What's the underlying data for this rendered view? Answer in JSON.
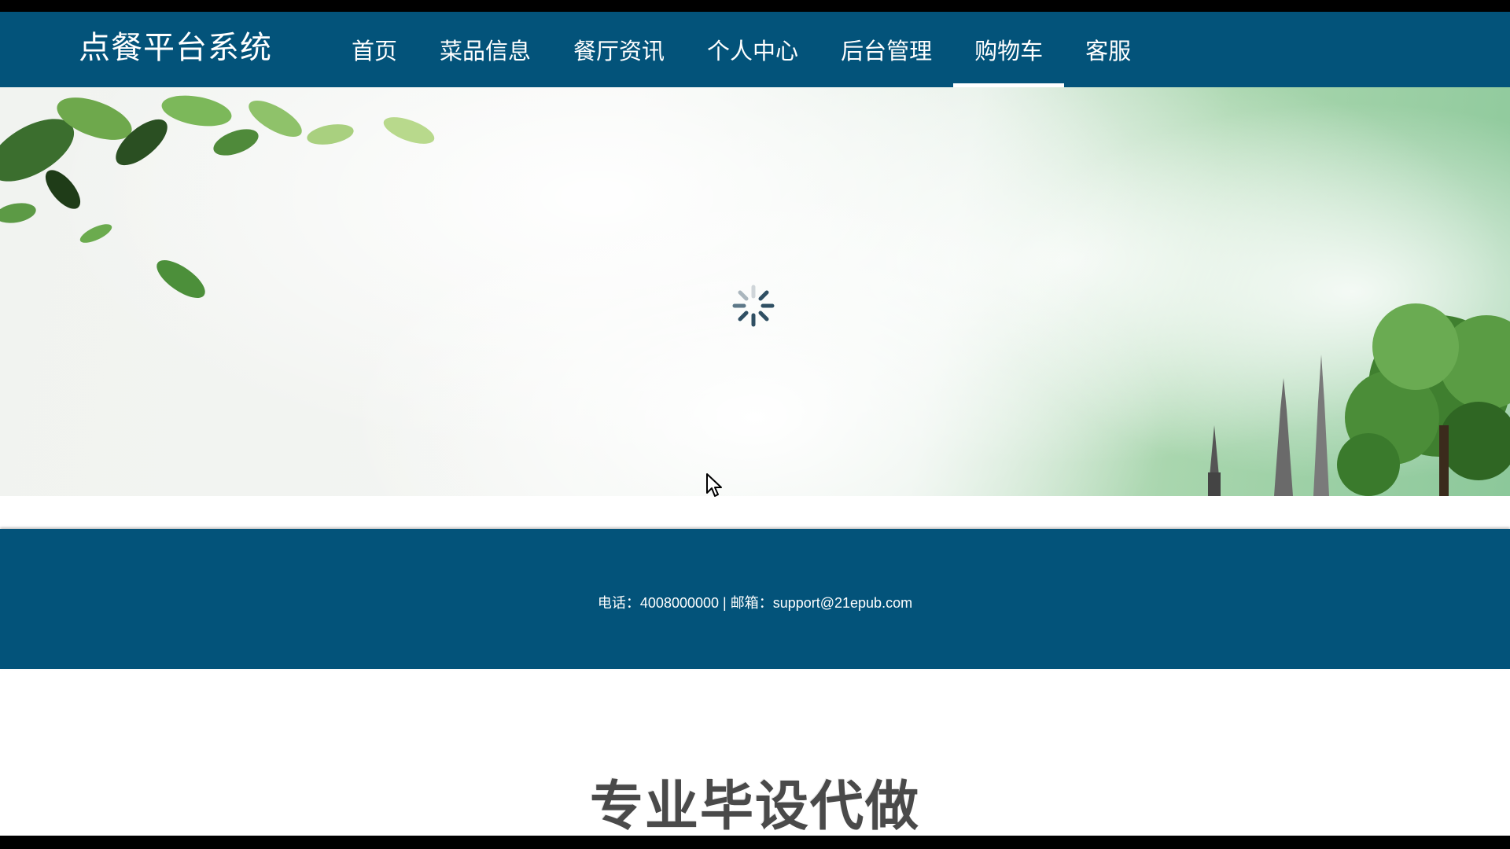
{
  "header": {
    "brand": "点餐平台系统",
    "nav": [
      {
        "label": "首页",
        "active": false
      },
      {
        "label": "菜品信息",
        "active": false
      },
      {
        "label": "餐厅资讯",
        "active": false
      },
      {
        "label": "个人中心",
        "active": false
      },
      {
        "label": "后台管理",
        "active": false
      },
      {
        "label": "购物车",
        "active": true
      },
      {
        "label": "客服",
        "active": false
      }
    ]
  },
  "banner": {
    "loading_icon": "spinner-icon"
  },
  "footer": {
    "contact": "电话：4008000000 | 邮箱：support@21epub.com"
  },
  "overlay": {
    "promo_text": "专业毕设代做"
  },
  "colors": {
    "header_bg": "#03537a",
    "footer_bg": "#03537a",
    "nav_text": "#ffffff"
  }
}
